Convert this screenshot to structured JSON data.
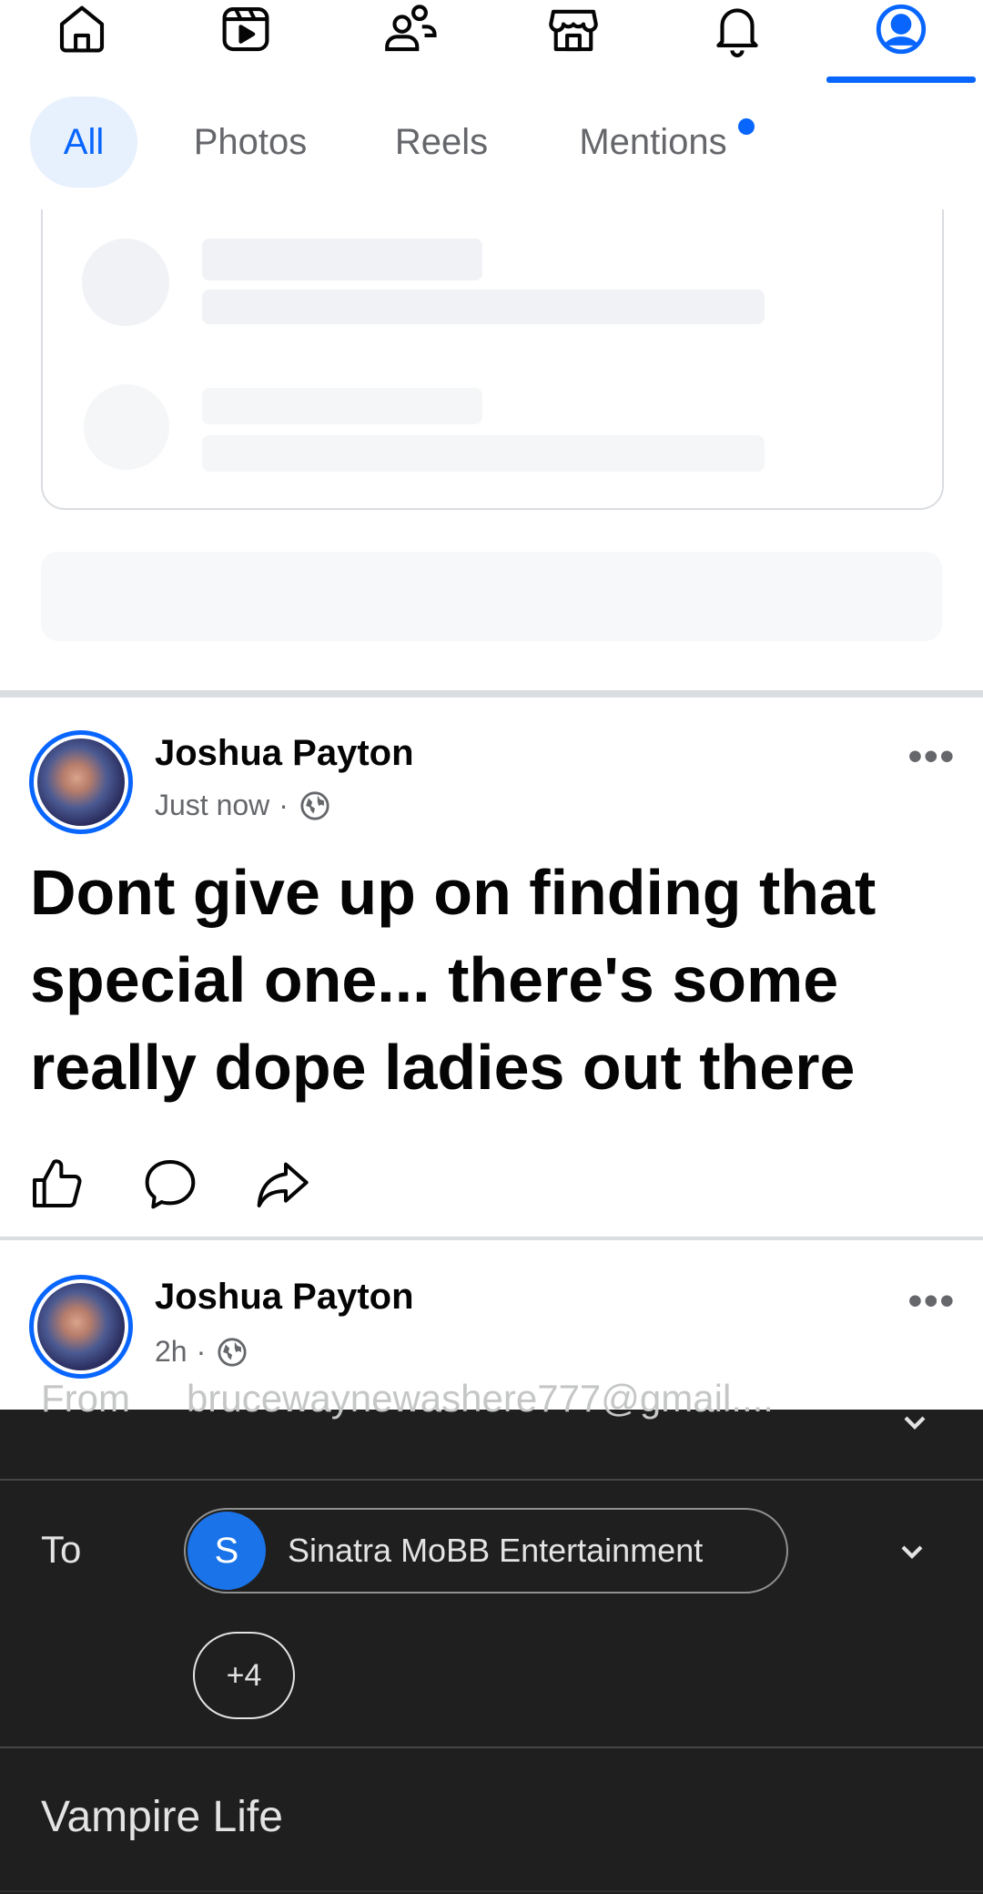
{
  "nav": {
    "icons": [
      "home-icon",
      "video-icon",
      "friends-icon",
      "marketplace-icon",
      "notifications-icon",
      "profile-icon"
    ],
    "active": "profile-icon",
    "accent": "#0866ff"
  },
  "filters": {
    "items": [
      "All",
      "Photos",
      "Reels",
      "Mentions"
    ],
    "active": "All",
    "mentions_has_badge": true
  },
  "posts": [
    {
      "author": "Joshua Payton",
      "time": "Just now",
      "separator": "·",
      "audience_icon": "globe-icon",
      "more": "•••",
      "text": "Dont give up on finding that special one... there's some really dope ladies out there",
      "actions": [
        "like-icon",
        "comment-icon",
        "share-icon"
      ]
    },
    {
      "author": "Joshua Payton",
      "time": "2h",
      "separator": "·",
      "audience_icon": "globe-icon",
      "more": "•••"
    }
  ],
  "email": {
    "from_label": "From",
    "from_value": "brucewaynewashere777@gmail....",
    "to_label": "To",
    "recipient_initial": "S",
    "recipient_name": "Sinatra MoBB Entertainment",
    "more_recipients": "+4",
    "subject": "Vampire Life"
  }
}
